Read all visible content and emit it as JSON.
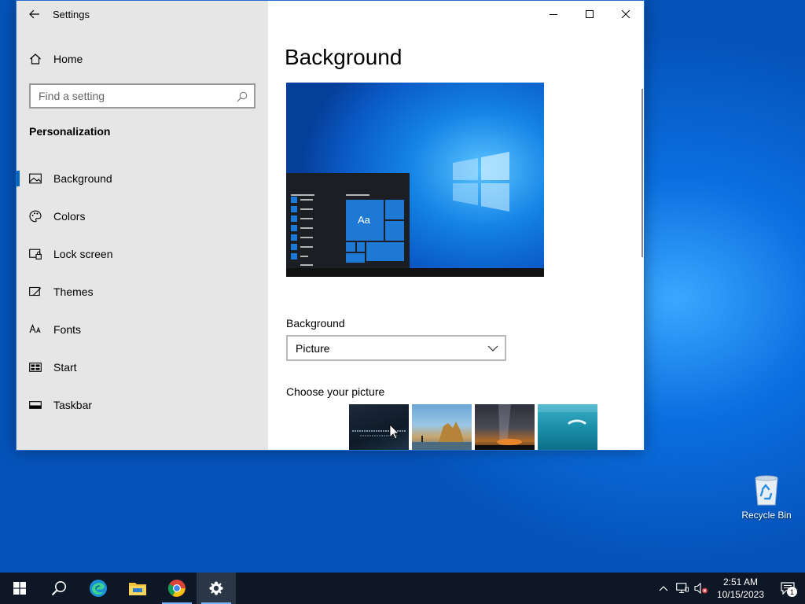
{
  "window": {
    "title": "Settings",
    "controls": {
      "minimize": "minimize",
      "maximize": "maximize",
      "close": "close"
    }
  },
  "sidebar": {
    "home_label": "Home",
    "search_placeholder": "Find a setting",
    "section_title": "Personalization",
    "items": [
      {
        "label": "Background",
        "icon": "picture-icon",
        "active": true
      },
      {
        "label": "Colors",
        "icon": "palette-icon"
      },
      {
        "label": "Lock screen",
        "icon": "lock-screen-icon"
      },
      {
        "label": "Themes",
        "icon": "themes-icon"
      },
      {
        "label": "Fonts",
        "icon": "fonts-icon"
      },
      {
        "label": "Start",
        "icon": "start-icon"
      },
      {
        "label": "Taskbar",
        "icon": "taskbar-icon"
      }
    ]
  },
  "main": {
    "page_title": "Background",
    "preview_tile_text": "Aa",
    "background_label": "Background",
    "background_value": "Picture",
    "choose_label": "Choose your picture",
    "thumbnails": [
      "night-sky-text",
      "beach-rocks",
      "milky-way",
      "underwater-swimmer"
    ]
  },
  "desktop": {
    "recycle_bin_label": "Recycle Bin"
  },
  "taskbar": {
    "apps": [
      "start-icon",
      "search-icon",
      "edge-icon",
      "file-explorer-icon",
      "chrome-icon",
      "settings-icon"
    ],
    "time": "2:51 AM",
    "date": "10/15/2023",
    "notification_count": "1"
  },
  "colors": {
    "accent": "#0067c0",
    "sidebar_bg": "#e6e6e6",
    "taskbar_bg": "#0d1726"
  }
}
